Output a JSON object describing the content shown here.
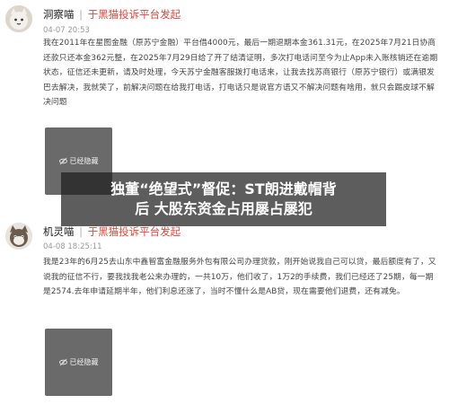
{
  "posts": [
    {
      "username": "洞察喵",
      "separator": "|",
      "via": "于黑猫投诉平台发起",
      "time": "04-07 20:53",
      "content": "我在2011年在星图金融（原苏宁金融）平台借4000元，最后一期退期本金361.31元，在2025年7月21日协商还款只还本金362元整，在2025年7月29日给了开了结清证明，多次打电话问至今为止App未入账核销还在逾期状态，征信还未更新，请及时处理，今天苏宁金融客服拨打电话来，让我去找苏商银行（原苏宁银行）或满银发巴去解决，我就笑了，前解决问题在给我打电话，打电话只是说官方语又不解决问题有啥用，就只会踢皮球不解决问题",
      "image_label": "已经隐藏"
    },
    {
      "username": "机灵喵",
      "separator": "|",
      "via": "于黑猫投诉平台发起",
      "time": "04-08 18:25:11",
      "content": "我是23年的6月25去山东中鑫智富金融服务外包有限公司办理贷款，刚开始说我自己可以贷，最后额度有了，又说我的征信不行，要我找我老公来办理的，一共10万，他们收了，1万2的手续费，我们已经还了25期，每一期是2574.去年申请延期半年，他们利息还涨了，当时不懂什么是AB贷，现在需要他们退费，还有减免。",
      "image_label": "已经隐藏"
    }
  ],
  "banner": {
    "line1": "独董“绝望式”督促：ST朗进戴帽背",
    "line2": "后  大股东资金占用屡占屡犯"
  }
}
